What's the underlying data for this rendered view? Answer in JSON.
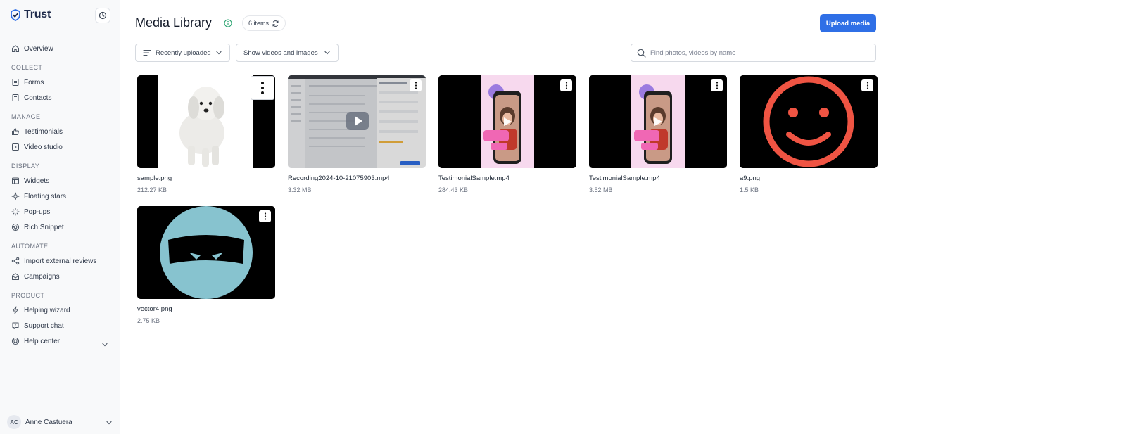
{
  "brand": {
    "name": "Trust"
  },
  "sidebar": {
    "items": [
      {
        "label": "Overview",
        "icon": "home-icon"
      },
      {
        "section": "COLLECT"
      },
      {
        "label": "Forms",
        "icon": "form-icon"
      },
      {
        "label": "Contacts",
        "icon": "contacts-icon"
      },
      {
        "section": "MANAGE"
      },
      {
        "label": "Testimonials",
        "icon": "thumbs-up-icon"
      },
      {
        "label": "Video studio",
        "icon": "video-icon"
      },
      {
        "section": "DISPLAY"
      },
      {
        "label": "Widgets",
        "icon": "widget-icon"
      },
      {
        "label": "Floating stars",
        "icon": "sparkle-icon"
      },
      {
        "label": "Pop-ups",
        "icon": "loader-icon"
      },
      {
        "label": "Rich Snippet",
        "icon": "chrome-icon"
      },
      {
        "section": "AUTOMATE"
      },
      {
        "label": "Import external reviews",
        "icon": "share-icon"
      },
      {
        "label": "Campaigns",
        "icon": "mail-open-icon"
      },
      {
        "section": "PRODUCT"
      },
      {
        "label": "Helping wizard",
        "icon": "bolt-icon"
      },
      {
        "label": "Support chat",
        "icon": "chat-icon"
      },
      {
        "label": "Help center",
        "icon": "lifebuoy-icon"
      }
    ],
    "user": {
      "initials": "AC",
      "name": "Anne Castuera"
    }
  },
  "header": {
    "title": "Media Library",
    "count": "6 items",
    "upload_label": "Upload media"
  },
  "filters": {
    "sort_label": "Recently uploaded",
    "type_label": "Show videos and images",
    "search_placeholder": "Find photos, videos by name"
  },
  "media": [
    {
      "name": "sample.png",
      "size": "212.27 KB",
      "kind": "image"
    },
    {
      "name": "Recording2024-10-21075903.mp4",
      "size": "3.32 MB",
      "kind": "video"
    },
    {
      "name": "TestimonialSample.mp4",
      "size": "284.43 KB",
      "kind": "video"
    },
    {
      "name": "TestimonialSample.mp4",
      "size": "3.52 MB",
      "kind": "video"
    },
    {
      "name": "a9.png",
      "size": "1.5 KB",
      "kind": "image"
    },
    {
      "name": "vector4.png",
      "size": "2.75 KB",
      "kind": "image"
    }
  ],
  "colors": {
    "accent": "#2f6fe6",
    "smiley": "#ef5443",
    "ninja": "#87c3cf",
    "phone_bg": "#f7d9ee"
  }
}
